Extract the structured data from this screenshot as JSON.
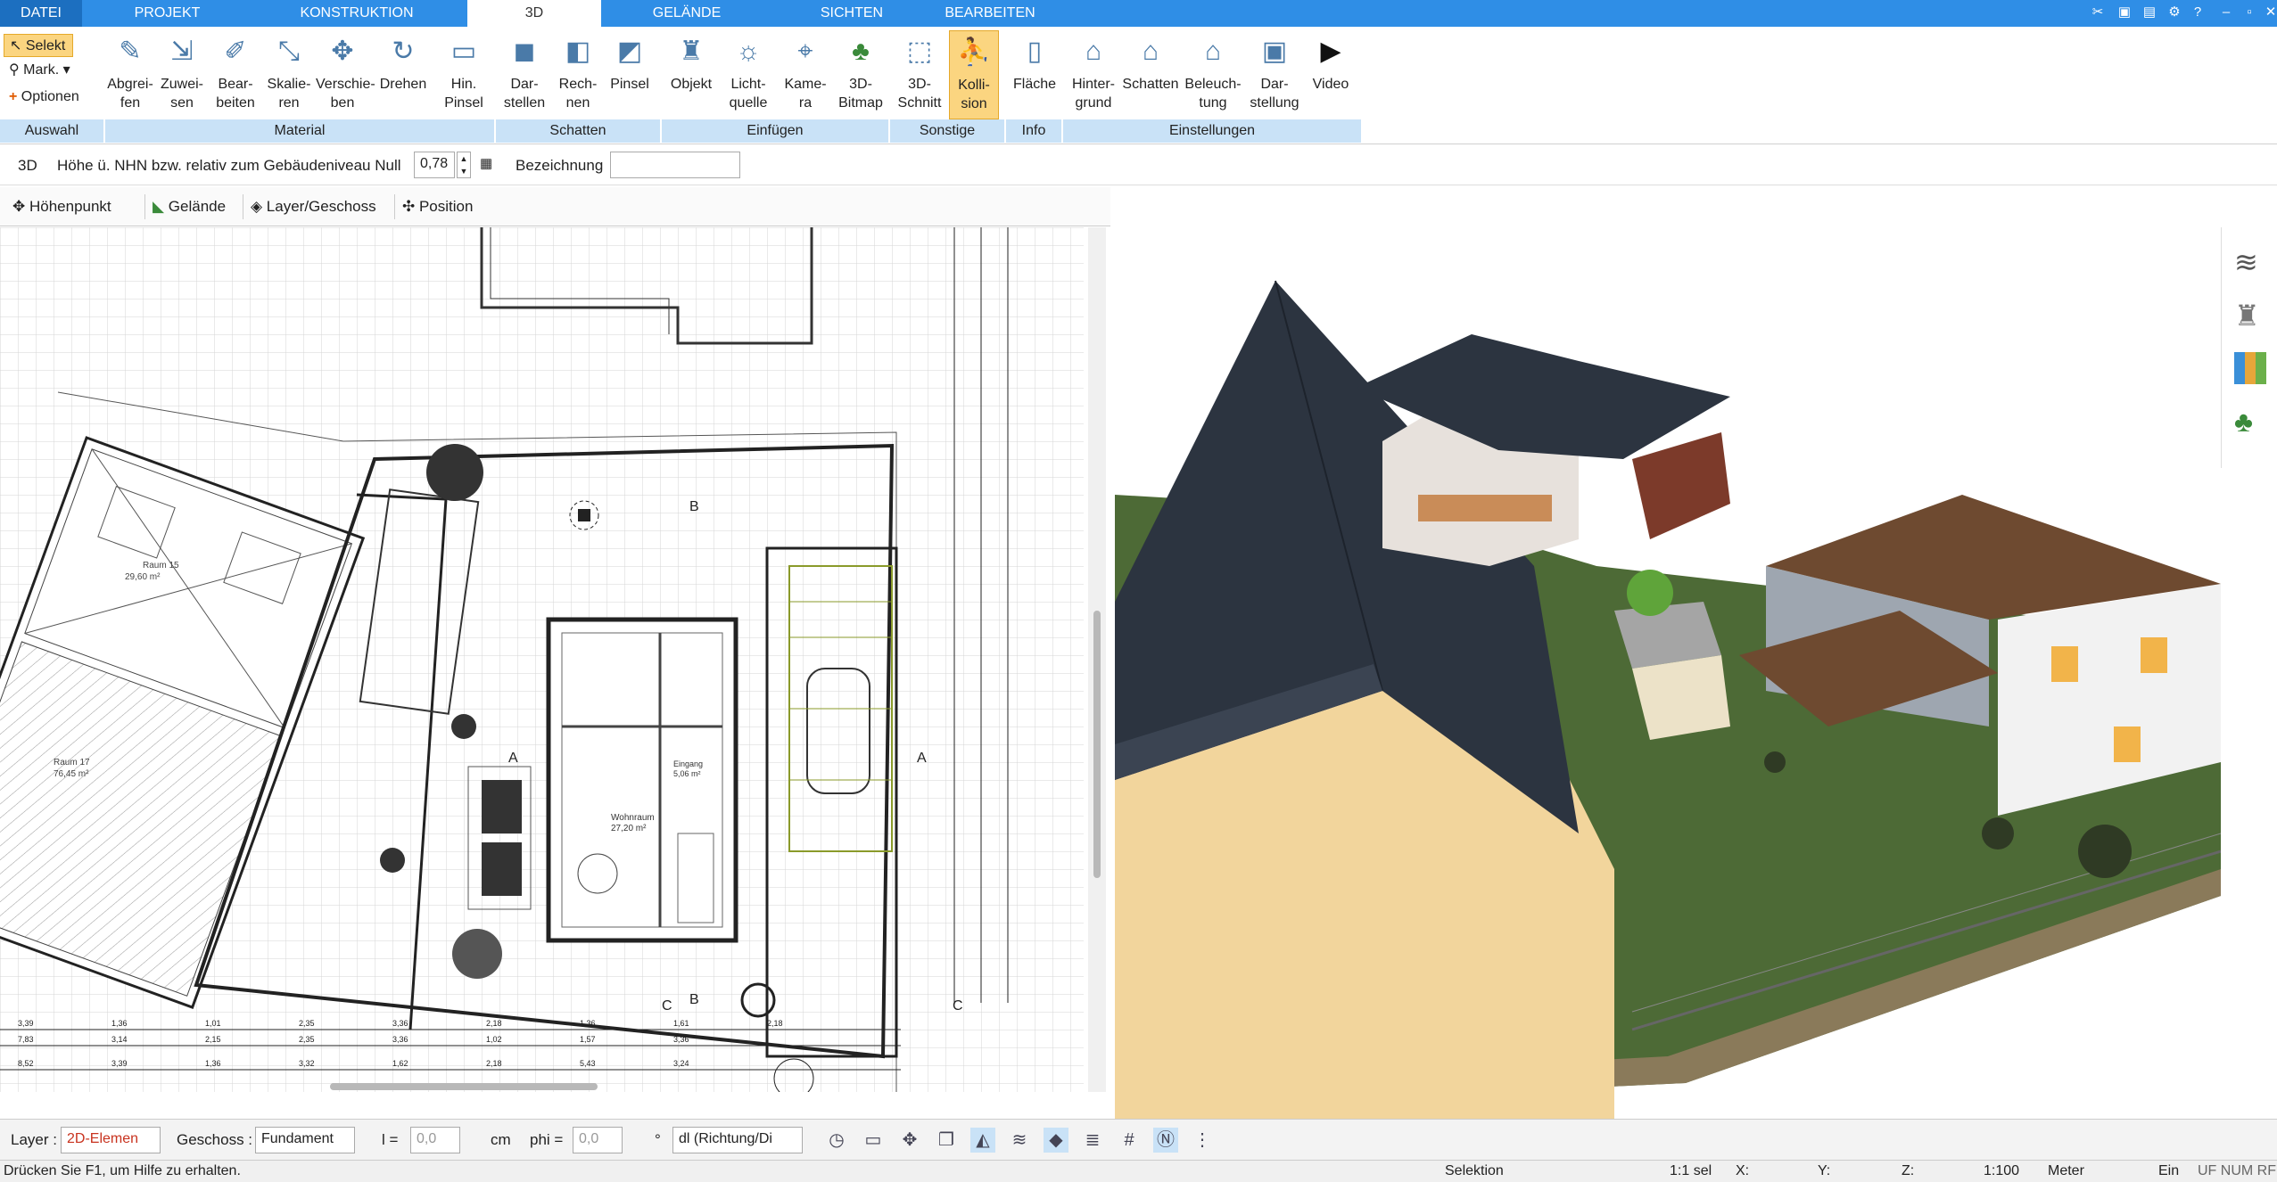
{
  "tabs": [
    {
      "label": "DATEI",
      "active": false
    },
    {
      "label": "PROJEKT",
      "active": false
    },
    {
      "label": "KONSTRUKTION",
      "active": false
    },
    {
      "label": "3D",
      "active": true
    },
    {
      "label": "GELÄNDE",
      "active": false
    },
    {
      "label": "SICHTEN",
      "active": false
    },
    {
      "label": "BEARBEITEN",
      "active": false
    }
  ],
  "window_controls": [
    "tools-icon",
    "save-icon",
    "copy-icon",
    "share-icon",
    "help-icon",
    "minimize-icon",
    "maximize-icon",
    "close-icon"
  ],
  "selection": {
    "items": [
      "Selekt",
      "Mark.",
      "Optionen"
    ],
    "group": "Auswahl"
  },
  "ribbon": {
    "material": {
      "group": "Material",
      "buttons": [
        "Abgrei-\nfen",
        "Zuwei-\nsen",
        "Bear-\nbeiten",
        "Skalie-\nren",
        "Verschie-\nben",
        "Drehen",
        "Hin.\nPinsel"
      ]
    },
    "schatten": {
      "group": "Schatten",
      "buttons": [
        "Dar-\nstellen",
        "Rech-\nnen",
        "Pinsel"
      ]
    },
    "einfuegen": {
      "group": "Einfügen",
      "buttons": [
        "Objekt",
        "Licht-\nquelle",
        "Kame-\nra",
        "3D-\nBitmap"
      ]
    },
    "sonstige": {
      "group": "Sonstige",
      "buttons": [
        "3D-\nSchnitt",
        "Kolli-\nsion"
      ]
    },
    "info": {
      "group": "Info",
      "buttons": [
        "Fläche"
      ]
    },
    "einstellungen": {
      "group": "Einstellungen",
      "buttons": [
        "Hinter-\ngrund",
        "Schatten",
        "Beleuch-\ntung",
        "Dar-\nstellung",
        "Video"
      ]
    }
  },
  "propbar": {
    "mode": "3D",
    "height_label": "Höhe ü. NHN bzw. relativ zum Gebäudeniveau Null",
    "height_value": "0,78",
    "name_label": "Bezeichnung",
    "name_value": ""
  },
  "toolbar2": {
    "items": [
      "Höhenpunkt",
      "Gelände",
      "Layer/Geschoss",
      "Position"
    ]
  },
  "plan": {
    "room_labels": [
      {
        "name": "Raum 15",
        "area": "29,60 m²"
      },
      {
        "name": "Raum 17",
        "area": "76,45 m²"
      },
      {
        "name": "Wohnraum",
        "area": "27,20 m²"
      },
      {
        "name": "Eingang",
        "area": "5,06 m²"
      }
    ],
    "section_marks": [
      "A",
      "A",
      "B",
      "B",
      "C",
      "C"
    ],
    "dims_row1": [
      "3,39",
      "1,36",
      "1,01",
      "2,35",
      "3,36",
      "2,18",
      "1,36",
      "1,61",
      "2,18"
    ],
    "dims_row2": [
      "7,83",
      "3,14",
      "2,15",
      "2,35",
      "3,36",
      "1,02",
      "1,57",
      "3,36"
    ],
    "dims_row3": [
      "8,52",
      "3,39",
      "1,36",
      "3,32",
      "1,62",
      "2,18",
      "5,43",
      "3,24"
    ]
  },
  "bottom": {
    "layer_label": "Layer :",
    "layer_value": "2D-Elemen",
    "geschoss_label": "Geschoss :",
    "geschoss_value": "Fundament",
    "l_label": "l =",
    "l_value": "0,0",
    "l_unit": "cm",
    "phi_label": "phi =",
    "phi_value": "0,0",
    "phi_unit": "°",
    "dl_value": "dl (Richtung/Di"
  },
  "status": {
    "help": "Drücken Sie F1, um Hilfe zu erhalten.",
    "mode": "Selektion",
    "sel": "1:1 sel",
    "x": "X:",
    "y": "Y:",
    "z": "Z:",
    "scale": "1:100",
    "unit": "Meter",
    "ein": "Ein",
    "flags": "UF NUM RF"
  },
  "colors": {
    "tabbar": "#2f8ee6",
    "group_bar": "#c9e2f7",
    "active_button": "#fbd580",
    "grass": "#4d6a36",
    "roof": "#2c3440",
    "wall_cream": "#f2d59c"
  }
}
